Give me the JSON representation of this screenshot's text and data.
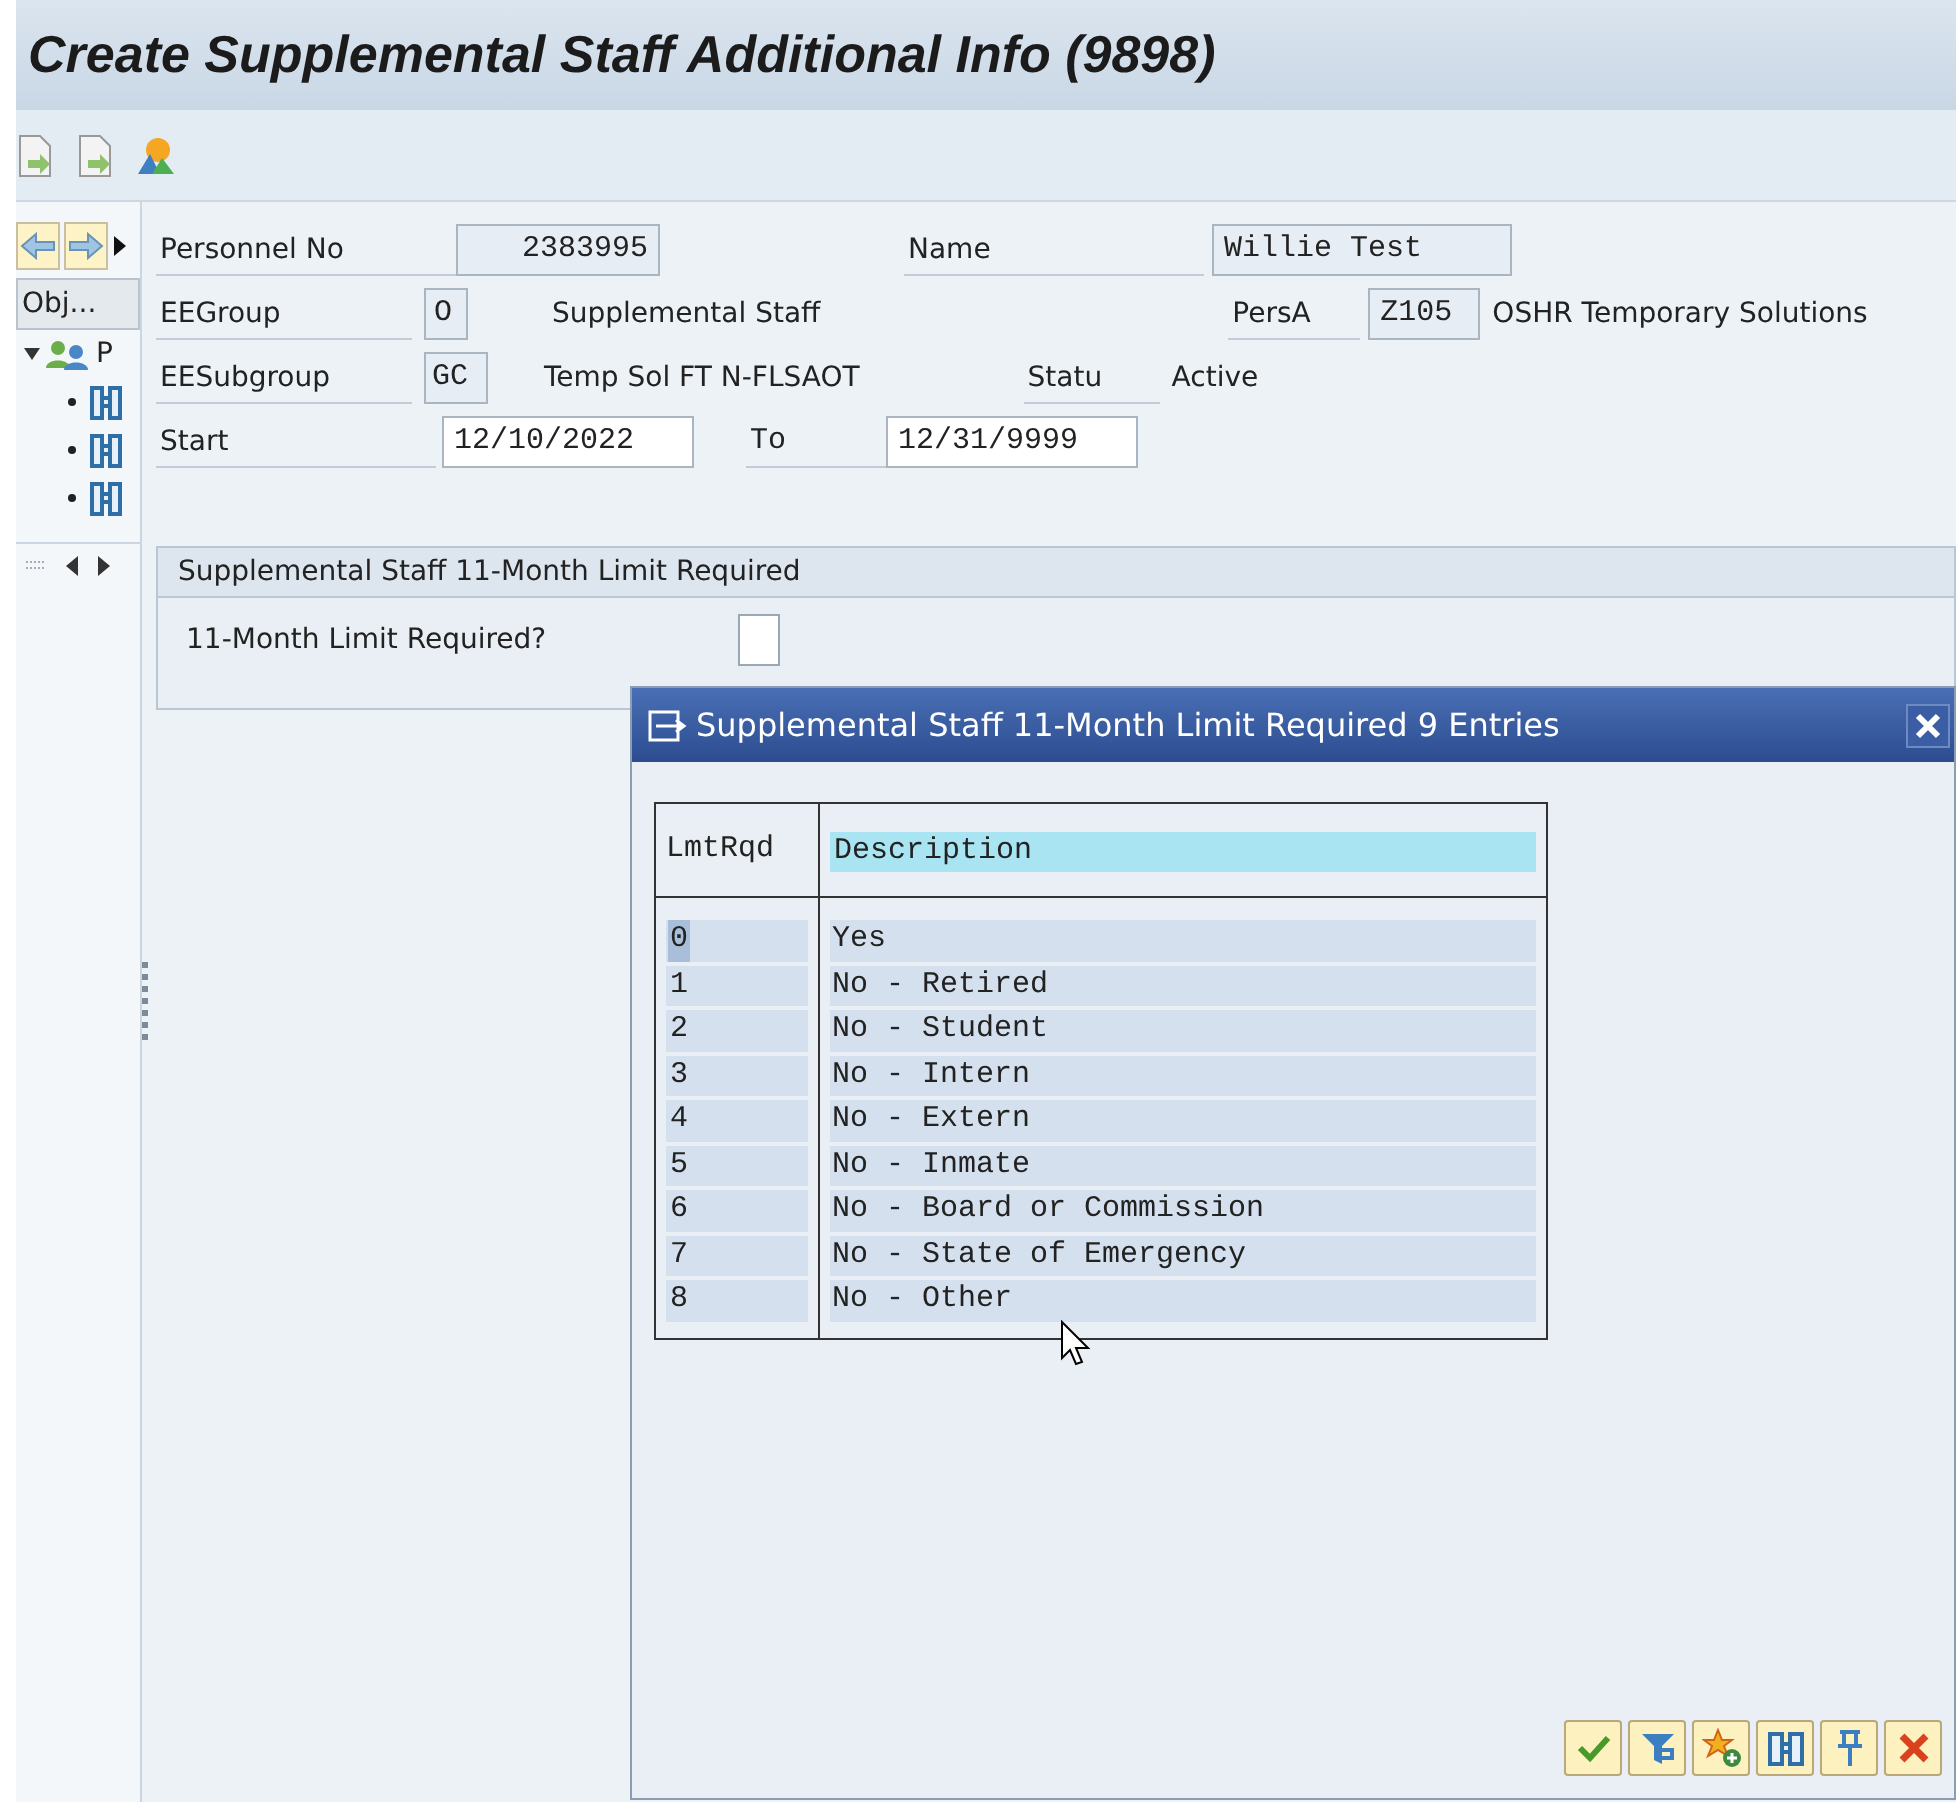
{
  "window": {
    "title": "Create Supplemental Staff Additional Info (9898)"
  },
  "nav": {
    "object_button": "Obj...",
    "tree_root": "P",
    "tree_children": [
      {
        "kind": "object"
      },
      {
        "kind": "object"
      },
      {
        "kind": "object"
      }
    ]
  },
  "header": {
    "personnel_no": {
      "label": "Personnel No",
      "value": "2383995"
    },
    "name": {
      "label": "Name",
      "value": "Willie Test"
    },
    "eegroup": {
      "label": "EEGroup",
      "value": "O",
      "text": "Supplemental Staff"
    },
    "persa": {
      "label": "PersA",
      "value": "Z105",
      "text": "OSHR Temporary Solutions"
    },
    "eesubgroup": {
      "label": "EESubgroup",
      "value": "GC",
      "text": "Temp Sol FT N-FLSAOT"
    },
    "status": {
      "label": "Statu",
      "text": "Active"
    },
    "start": {
      "label": "Start",
      "value": "12/10/2022"
    },
    "to": {
      "label": "To",
      "value": "12/31/9999"
    }
  },
  "group": {
    "title": "Supplemental Staff 11-Month Limit Required",
    "field_label": "11-Month Limit Required?",
    "checked": false
  },
  "dialog": {
    "title": "Supplemental Staff 11-Month Limit Required 9 Entries",
    "columns": [
      "LmtRqd",
      "Description"
    ],
    "rows": [
      {
        "key": "0",
        "description": "Yes",
        "focused": true
      },
      {
        "key": "1",
        "description": "No - Retired",
        "focused": false
      },
      {
        "key": "2",
        "description": "No - Student",
        "focused": false
      },
      {
        "key": "3",
        "description": "No - Intern",
        "focused": false
      },
      {
        "key": "4",
        "description": "No - Extern",
        "focused": false
      },
      {
        "key": "5",
        "description": "No - Inmate",
        "focused": false
      },
      {
        "key": "6",
        "description": "No - Board or Commission",
        "focused": false
      },
      {
        "key": "7",
        "description": "No - State of Emergency",
        "focused": false
      },
      {
        "key": "8",
        "description": "No - Other",
        "focused": false
      }
    ],
    "buttons": [
      {
        "kind": "confirm"
      },
      {
        "kind": "filter"
      },
      {
        "kind": "favorite"
      },
      {
        "kind": "search"
      },
      {
        "kind": "pin"
      },
      {
        "kind": "cancel"
      }
    ]
  }
}
